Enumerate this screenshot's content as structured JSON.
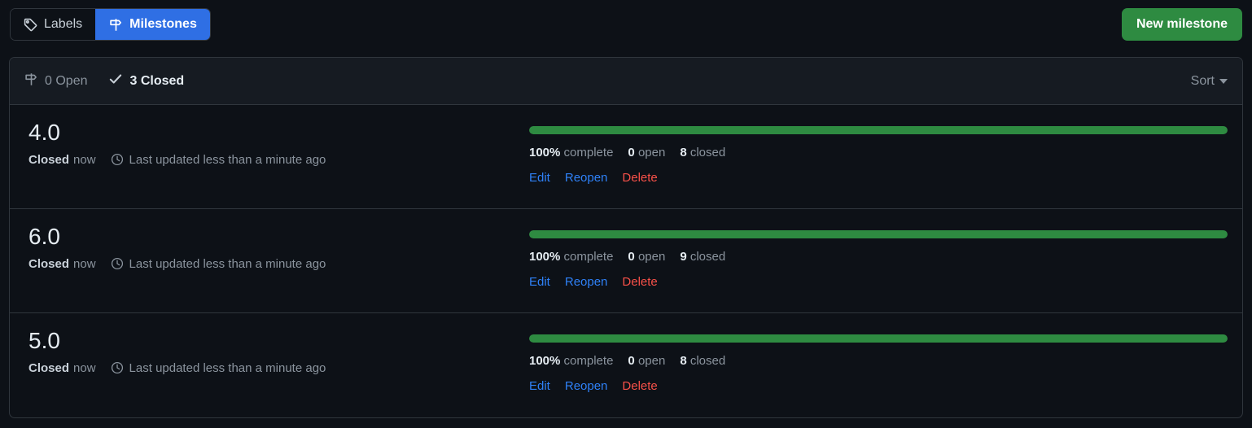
{
  "tabs": [
    {
      "label": "Labels",
      "icon": "tag-icon",
      "active": false
    },
    {
      "label": "Milestones",
      "icon": "milestone-icon",
      "active": true
    }
  ],
  "new_milestone_button": "New milestone",
  "filters": {
    "open": {
      "count_label": "0 Open",
      "icon": "milestone-icon"
    },
    "closed": {
      "count_label": "3 Closed",
      "icon": "check-icon"
    },
    "sort_label": "Sort"
  },
  "milestones": [
    {
      "title": "4.0",
      "state": "Closed",
      "when": "now",
      "updated": "Last updated less than a minute ago",
      "percent_label": "100%",
      "complete_label": "complete",
      "percent_value": 100,
      "open_count": "0",
      "open_label": "open",
      "closed_count": "8",
      "closed_label": "closed",
      "actions": {
        "edit": "Edit",
        "reopen": "Reopen",
        "delete": "Delete"
      }
    },
    {
      "title": "6.0",
      "state": "Closed",
      "when": "now",
      "updated": "Last updated less than a minute ago",
      "percent_label": "100%",
      "complete_label": "complete",
      "percent_value": 100,
      "open_count": "0",
      "open_label": "open",
      "closed_count": "9",
      "closed_label": "closed",
      "actions": {
        "edit": "Edit",
        "reopen": "Reopen",
        "delete": "Delete"
      }
    },
    {
      "title": "5.0",
      "state": "Closed",
      "when": "now",
      "updated": "Last updated less than a minute ago",
      "percent_label": "100%",
      "complete_label": "complete",
      "percent_value": 100,
      "open_count": "0",
      "open_label": "open",
      "closed_count": "8",
      "closed_label": "closed",
      "actions": {
        "edit": "Edit",
        "reopen": "Reopen",
        "delete": "Delete"
      }
    }
  ],
  "colors": {
    "page_background": "#0d1117",
    "header_background": "#161b22",
    "border": "#30363d",
    "accent_blue": "#2f6fe4",
    "link_blue": "#2f81f7",
    "success_green": "#2e8b41",
    "danger_red": "#f85149",
    "text_primary": "#e6edf3",
    "text_muted": "#8b949e"
  }
}
